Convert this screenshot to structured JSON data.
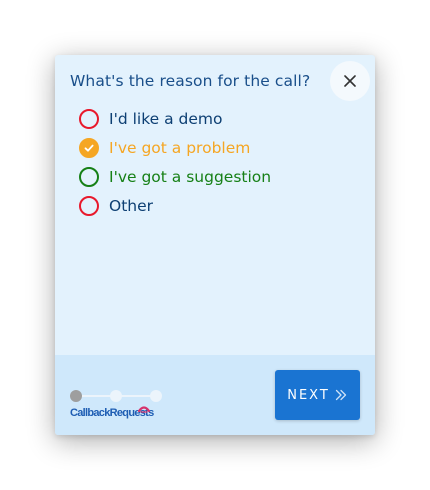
{
  "dialog": {
    "question": "What's the reason for the call?",
    "close_icon": "close-icon"
  },
  "options": [
    {
      "label": "I'd like a demo",
      "color": "#0d3f73",
      "ring": "#e8192c",
      "checked": false
    },
    {
      "label": "I've got a problem",
      "color": "#f5a623",
      "ring": "#f5a623",
      "checked": true
    },
    {
      "label": "I've got a suggestion",
      "color": "#168016",
      "ring": "#168016",
      "checked": false
    },
    {
      "label": "Other",
      "color": "#0d3f73",
      "ring": "#e8192c",
      "checked": false
    }
  ],
  "footer": {
    "progress": {
      "steps": 3,
      "current": 1
    },
    "brand": "CallbackRequests",
    "next_label": "NEXT",
    "next_icon": "double-chevron-right-icon"
  },
  "colors": {
    "panel": "#e3f2fd",
    "footer": "#cfe8fb",
    "accent": "#1a74d2",
    "question_text": "#1a4f8a"
  }
}
